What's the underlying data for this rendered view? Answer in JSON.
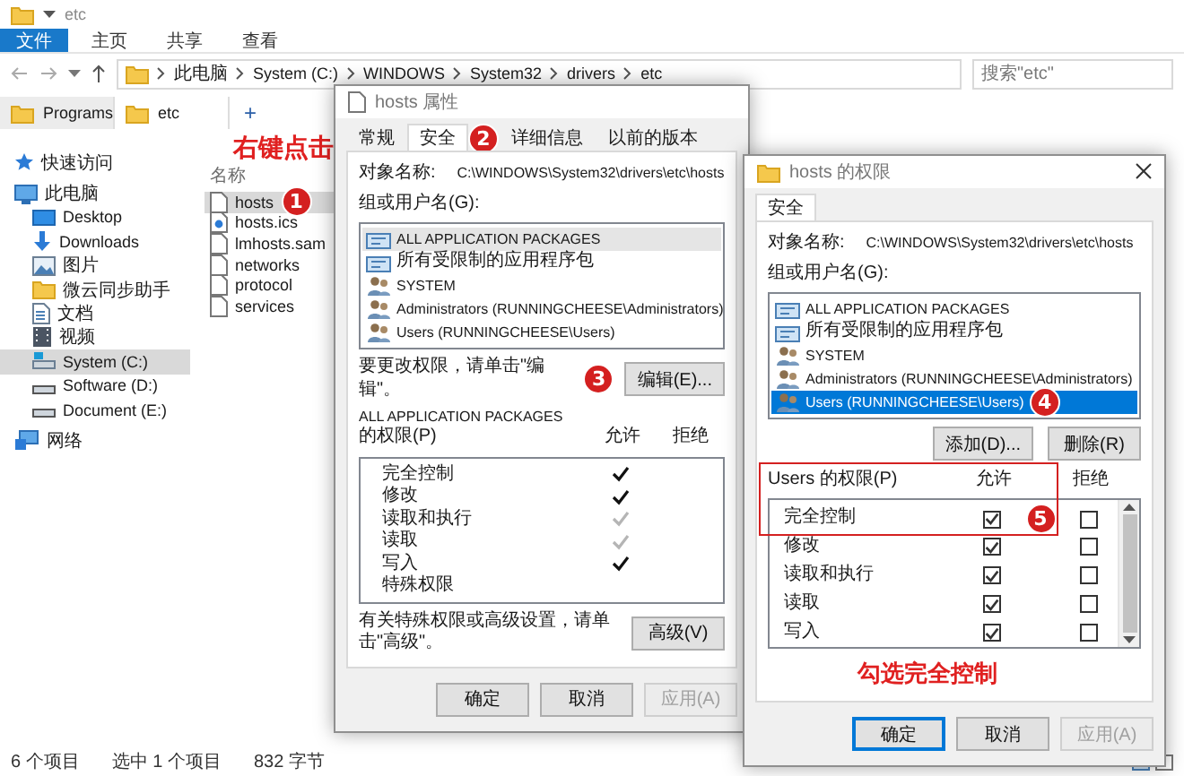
{
  "explorer": {
    "title": "etc",
    "ribbon_tabs": [
      {
        "label": "文件",
        "selected": true
      },
      {
        "label": "主页",
        "selected": false
      },
      {
        "label": "共享",
        "selected": false
      },
      {
        "label": "查看",
        "selected": false
      }
    ],
    "breadcrumb": [
      "此电脑",
      "System (C:)",
      "WINDOWS",
      "System32",
      "drivers",
      "etc"
    ],
    "search": {
      "placeholder": "搜索\"etc\""
    },
    "folder_tabs": [
      {
        "label": "Programs",
        "selected": false
      },
      {
        "label": "etc",
        "selected": true
      }
    ],
    "new_tab": "+",
    "nav": [
      {
        "label": "快速访问",
        "kind": "star",
        "selected": false
      },
      {
        "label": "此电脑",
        "kind": "pc",
        "selected": false,
        "children": [
          {
            "label": "Desktop",
            "kind": "desktop",
            "selected": false
          },
          {
            "label": "Downloads",
            "kind": "download",
            "selected": false
          },
          {
            "label": "图片",
            "kind": "pictures",
            "selected": false
          },
          {
            "label": "微云同步助手",
            "kind": "folder",
            "selected": false
          },
          {
            "label": "文档",
            "kind": "documents",
            "selected": false
          },
          {
            "label": "视频",
            "kind": "video",
            "selected": false
          },
          {
            "label": "System (C:)",
            "kind": "system-drive",
            "selected": true
          },
          {
            "label": "Software (D:)",
            "kind": "drive",
            "selected": false
          },
          {
            "label": "Document (E:)",
            "kind": "drive",
            "selected": false
          }
        ]
      },
      {
        "label": "网络",
        "kind": "network",
        "selected": false
      }
    ],
    "column_header": "名称",
    "files": [
      {
        "name": "hosts",
        "kind": "file",
        "selected": true
      },
      {
        "name": "hosts.ics",
        "kind": "ics",
        "selected": false
      },
      {
        "name": "lmhosts.sam",
        "kind": "file",
        "selected": false
      },
      {
        "name": "networks",
        "kind": "file",
        "selected": false
      },
      {
        "name": "protocol",
        "kind": "file",
        "selected": false
      },
      {
        "name": "services",
        "kind": "file",
        "selected": false
      }
    ],
    "status": [
      "6 个项目",
      "选中 1 个项目",
      "832 字节"
    ]
  },
  "props": {
    "title": "hosts 属性",
    "tabs": [
      {
        "label": "常规",
        "selected": false
      },
      {
        "label": "安全",
        "selected": true
      },
      {
        "label": "详细信息",
        "selected": false
      },
      {
        "label": "以前的版本",
        "selected": false
      }
    ],
    "object_label": "对象名称:",
    "object_value": "C:\\WINDOWS\\System32\\drivers\\etc\\hosts",
    "groups_label": "组或用户名(G):",
    "principals": [
      {
        "name": "ALL APPLICATION PACKAGES",
        "kind": "package",
        "selected": true
      },
      {
        "name": "所有受限制的应用程序包",
        "kind": "package",
        "selected": false
      },
      {
        "name": "SYSTEM",
        "kind": "user",
        "selected": false
      },
      {
        "name": "Administrators (RUNNINGCHEESE\\Administrators)",
        "kind": "user",
        "selected": false
      },
      {
        "name": "Users (RUNNINGCHEESE\\Users)",
        "kind": "user",
        "selected": false
      }
    ],
    "change_hint": "要更改权限，请单击\"编辑\"。",
    "edit_button": "编辑(E)...",
    "permissions_for": "ALL APPLICATION PACKAGES",
    "permissions_label": "的权限(P)",
    "allow_header": "允许",
    "deny_header": "拒绝",
    "permissions": [
      {
        "name": "完全控制",
        "allowed": true,
        "disabled": false
      },
      {
        "name": "修改",
        "allowed": true,
        "disabled": false
      },
      {
        "name": "读取和执行",
        "allowed": true,
        "disabled": true
      },
      {
        "name": "读取",
        "allowed": true,
        "disabled": true
      },
      {
        "name": "写入",
        "allowed": true,
        "disabled": false
      },
      {
        "name": "特殊权限",
        "allowed": false
      }
    ],
    "advanced_hint": "有关特殊权限或高级设置，请单击\"高级\"。",
    "advanced_button": "高级(V)",
    "buttons": [
      {
        "label": "确定",
        "disabled": false
      },
      {
        "label": "取消",
        "disabled": false
      },
      {
        "label": "应用(A)",
        "disabled": true
      }
    ]
  },
  "perms": {
    "title": "hosts 的权限",
    "tabs": [
      {
        "label": "安全",
        "selected": true
      }
    ],
    "object_label": "对象名称:",
    "object_value": "C:\\WINDOWS\\System32\\drivers\\etc\\hosts",
    "groups_label": "组或用户名(G):",
    "principals": [
      {
        "name": "ALL APPLICATION PACKAGES",
        "kind": "package",
        "selected": false
      },
      {
        "name": "所有受限制的应用程序包",
        "kind": "package",
        "selected": false
      },
      {
        "name": "SYSTEM",
        "kind": "user",
        "selected": false
      },
      {
        "name": "Administrators (RUNNINGCHEESE\\Administrators)",
        "kind": "user",
        "selected": false
      },
      {
        "name": "Users (RUNNINGCHEESE\\Users)",
        "kind": "user",
        "selected": true
      }
    ],
    "add_button": "添加(D)...",
    "remove_button": "删除(R)",
    "permissions_label": "Users 的权限(P)",
    "allow_header": "允许",
    "deny_header": "拒绝",
    "permissions": [
      {
        "name": "完全控制",
        "allow": true,
        "deny": false
      },
      {
        "name": "修改",
        "allow": true,
        "deny": false
      },
      {
        "name": "读取和执行",
        "allow": true,
        "deny": false
      },
      {
        "name": "读取",
        "allow": true,
        "deny": false
      },
      {
        "name": "写入",
        "allow": true,
        "deny": false
      }
    ],
    "buttons": [
      {
        "label": "确定",
        "default": true,
        "disabled": false
      },
      {
        "label": "取消",
        "default": false,
        "disabled": false
      },
      {
        "label": "应用(A)",
        "default": false,
        "disabled": true
      }
    ]
  },
  "annotations": {
    "badges": [
      "1",
      "2",
      "3",
      "4",
      "5"
    ],
    "callouts": [
      "右键点击",
      "勾选完全控制"
    ]
  }
}
